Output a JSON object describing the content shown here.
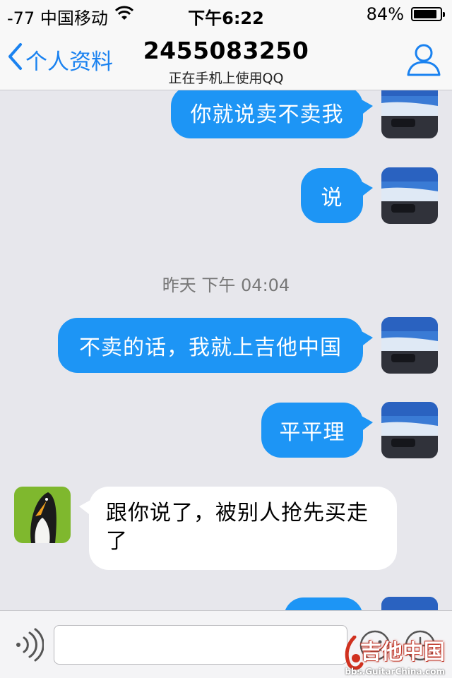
{
  "status_bar": {
    "carrier": "-77 中国移动",
    "time": "下午6:22",
    "battery": "84%"
  },
  "nav": {
    "back_label": "个人资料",
    "title": "2455083250",
    "subtitle": "正在手机上使用QQ"
  },
  "messages": [
    {
      "direction": "out",
      "text": "你就说卖不卖我"
    },
    {
      "direction": "out",
      "text": "说"
    },
    {
      "direction": "out",
      "text": "不卖的话，我就上吉他中国"
    },
    {
      "direction": "out",
      "text": "平平理"
    },
    {
      "direction": "in",
      "text": "跟你说了，被别人抢先买走了"
    },
    {
      "direction": "out",
      "text": ""
    }
  ],
  "timestamp": "昨天  下午 04:04",
  "input": {
    "placeholder": ""
  },
  "watermark": {
    "logo_text": "吉他中国",
    "url": "bbs.GuitarChina.com"
  },
  "colors": {
    "accent": "#1a82f0",
    "bubble_out": "#1d95f5",
    "background": "#e7e7ec"
  },
  "icons": [
    "chevron-left-icon",
    "wifi-icon",
    "battery-icon",
    "person-icon",
    "voice-icon",
    "emoji-icon",
    "plus-icon"
  ]
}
